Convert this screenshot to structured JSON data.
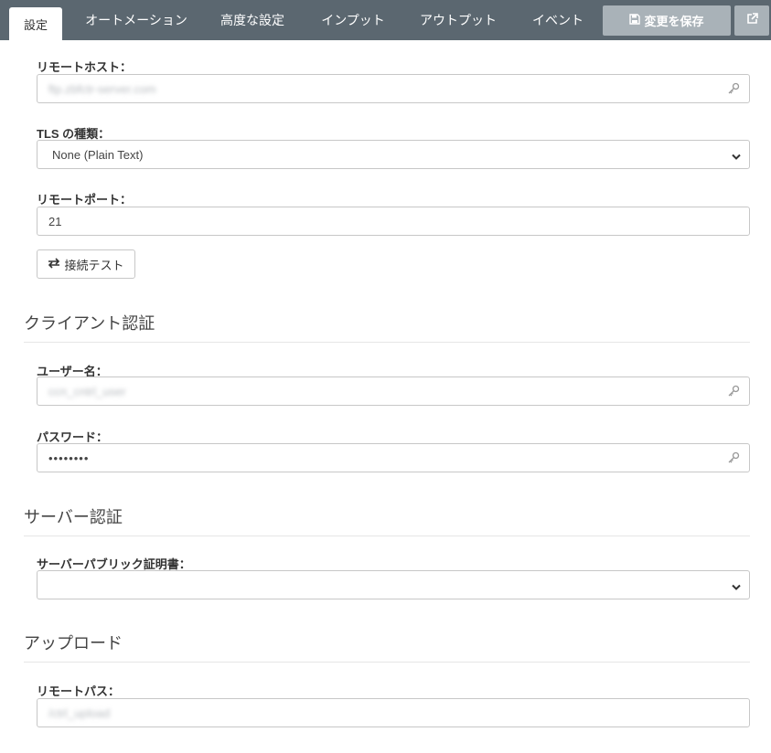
{
  "tabs": [
    {
      "label": "設定",
      "active": true
    },
    {
      "label": "オートメーション"
    },
    {
      "label": "高度な設定"
    },
    {
      "label": "インプット"
    },
    {
      "label": "アウトプット"
    },
    {
      "label": "イベント"
    }
  ],
  "toolbar": {
    "save_label": "変更を保存",
    "save_icon": "floppy-disk-icon",
    "external_icon": "external-link-icon"
  },
  "remote_host": {
    "label": "リモートホスト：",
    "value": "ftp.zbfctr-server.com"
  },
  "tls_type": {
    "label": "TLS の種類：",
    "value": "None (Plain Text)"
  },
  "remote_port": {
    "label": "リモートポート：",
    "value": "21"
  },
  "test_button": {
    "label": "接続テスト",
    "icon": "exchange-arrows-icon"
  },
  "client_auth": {
    "heading": "クライアント認証",
    "username": {
      "label": "ユーザー名：",
      "value": "ccn_cntrl_user"
    },
    "password": {
      "label": "パスワード：",
      "value": "••••••••"
    }
  },
  "server_auth": {
    "heading": "サーバー認証",
    "certificate": {
      "label": "サーバーパブリック証明書：",
      "value": ""
    }
  },
  "upload": {
    "heading": "アップロード",
    "remote_path": {
      "label": "リモートパス：",
      "value": "/ctrl_upload"
    }
  },
  "colors": {
    "topbar": "#5b6770",
    "button_gray": "#a9b2b8",
    "border": "#c7c7c7"
  }
}
